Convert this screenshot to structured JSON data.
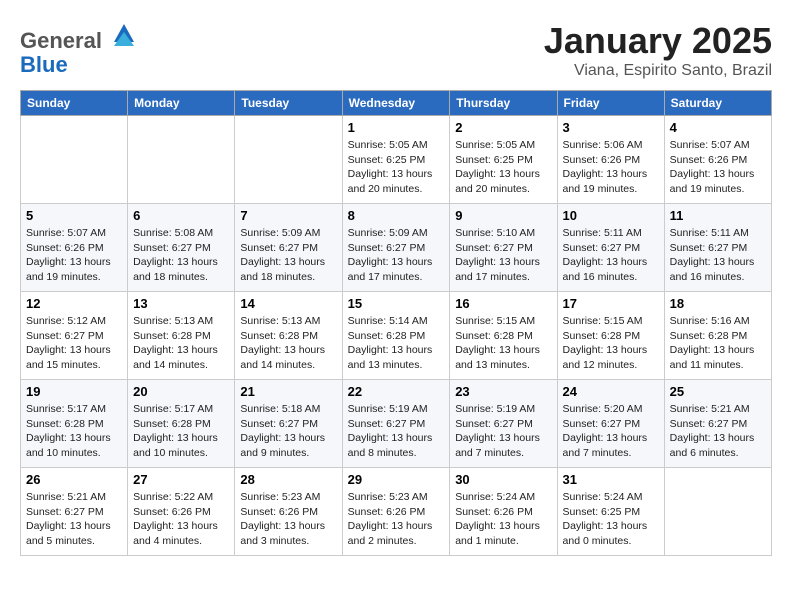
{
  "header": {
    "logo_line1": "General",
    "logo_line2": "Blue",
    "month": "January 2025",
    "location": "Viana, Espirito Santo, Brazil"
  },
  "days_of_week": [
    "Sunday",
    "Monday",
    "Tuesday",
    "Wednesday",
    "Thursday",
    "Friday",
    "Saturday"
  ],
  "weeks": [
    [
      {
        "day": "",
        "info": ""
      },
      {
        "day": "",
        "info": ""
      },
      {
        "day": "",
        "info": ""
      },
      {
        "day": "1",
        "info": "Sunrise: 5:05 AM\nSunset: 6:25 PM\nDaylight: 13 hours\nand 20 minutes."
      },
      {
        "day": "2",
        "info": "Sunrise: 5:05 AM\nSunset: 6:25 PM\nDaylight: 13 hours\nand 20 minutes."
      },
      {
        "day": "3",
        "info": "Sunrise: 5:06 AM\nSunset: 6:26 PM\nDaylight: 13 hours\nand 19 minutes."
      },
      {
        "day": "4",
        "info": "Sunrise: 5:07 AM\nSunset: 6:26 PM\nDaylight: 13 hours\nand 19 minutes."
      }
    ],
    [
      {
        "day": "5",
        "info": "Sunrise: 5:07 AM\nSunset: 6:26 PM\nDaylight: 13 hours\nand 19 minutes."
      },
      {
        "day": "6",
        "info": "Sunrise: 5:08 AM\nSunset: 6:27 PM\nDaylight: 13 hours\nand 18 minutes."
      },
      {
        "day": "7",
        "info": "Sunrise: 5:09 AM\nSunset: 6:27 PM\nDaylight: 13 hours\nand 18 minutes."
      },
      {
        "day": "8",
        "info": "Sunrise: 5:09 AM\nSunset: 6:27 PM\nDaylight: 13 hours\nand 17 minutes."
      },
      {
        "day": "9",
        "info": "Sunrise: 5:10 AM\nSunset: 6:27 PM\nDaylight: 13 hours\nand 17 minutes."
      },
      {
        "day": "10",
        "info": "Sunrise: 5:11 AM\nSunset: 6:27 PM\nDaylight: 13 hours\nand 16 minutes."
      },
      {
        "day": "11",
        "info": "Sunrise: 5:11 AM\nSunset: 6:27 PM\nDaylight: 13 hours\nand 16 minutes."
      }
    ],
    [
      {
        "day": "12",
        "info": "Sunrise: 5:12 AM\nSunset: 6:27 PM\nDaylight: 13 hours\nand 15 minutes."
      },
      {
        "day": "13",
        "info": "Sunrise: 5:13 AM\nSunset: 6:28 PM\nDaylight: 13 hours\nand 14 minutes."
      },
      {
        "day": "14",
        "info": "Sunrise: 5:13 AM\nSunset: 6:28 PM\nDaylight: 13 hours\nand 14 minutes."
      },
      {
        "day": "15",
        "info": "Sunrise: 5:14 AM\nSunset: 6:28 PM\nDaylight: 13 hours\nand 13 minutes."
      },
      {
        "day": "16",
        "info": "Sunrise: 5:15 AM\nSunset: 6:28 PM\nDaylight: 13 hours\nand 13 minutes."
      },
      {
        "day": "17",
        "info": "Sunrise: 5:15 AM\nSunset: 6:28 PM\nDaylight: 13 hours\nand 12 minutes."
      },
      {
        "day": "18",
        "info": "Sunrise: 5:16 AM\nSunset: 6:28 PM\nDaylight: 13 hours\nand 11 minutes."
      }
    ],
    [
      {
        "day": "19",
        "info": "Sunrise: 5:17 AM\nSunset: 6:28 PM\nDaylight: 13 hours\nand 10 minutes."
      },
      {
        "day": "20",
        "info": "Sunrise: 5:17 AM\nSunset: 6:28 PM\nDaylight: 13 hours\nand 10 minutes."
      },
      {
        "day": "21",
        "info": "Sunrise: 5:18 AM\nSunset: 6:27 PM\nDaylight: 13 hours\nand 9 minutes."
      },
      {
        "day": "22",
        "info": "Sunrise: 5:19 AM\nSunset: 6:27 PM\nDaylight: 13 hours\nand 8 minutes."
      },
      {
        "day": "23",
        "info": "Sunrise: 5:19 AM\nSunset: 6:27 PM\nDaylight: 13 hours\nand 7 minutes."
      },
      {
        "day": "24",
        "info": "Sunrise: 5:20 AM\nSunset: 6:27 PM\nDaylight: 13 hours\nand 7 minutes."
      },
      {
        "day": "25",
        "info": "Sunrise: 5:21 AM\nSunset: 6:27 PM\nDaylight: 13 hours\nand 6 minutes."
      }
    ],
    [
      {
        "day": "26",
        "info": "Sunrise: 5:21 AM\nSunset: 6:27 PM\nDaylight: 13 hours\nand 5 minutes."
      },
      {
        "day": "27",
        "info": "Sunrise: 5:22 AM\nSunset: 6:26 PM\nDaylight: 13 hours\nand 4 minutes."
      },
      {
        "day": "28",
        "info": "Sunrise: 5:23 AM\nSunset: 6:26 PM\nDaylight: 13 hours\nand 3 minutes."
      },
      {
        "day": "29",
        "info": "Sunrise: 5:23 AM\nSunset: 6:26 PM\nDaylight: 13 hours\nand 2 minutes."
      },
      {
        "day": "30",
        "info": "Sunrise: 5:24 AM\nSunset: 6:26 PM\nDaylight: 13 hours\nand 1 minute."
      },
      {
        "day": "31",
        "info": "Sunrise: 5:24 AM\nSunset: 6:25 PM\nDaylight: 13 hours\nand 0 minutes."
      },
      {
        "day": "",
        "info": ""
      }
    ]
  ]
}
